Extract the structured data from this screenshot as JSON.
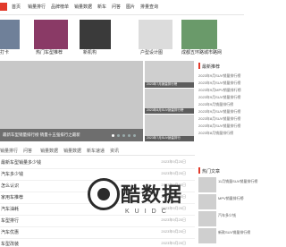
{
  "nav": {
    "items": [
      "首页",
      "销量排行",
      "品牌榜单",
      "销量数据",
      "新车",
      "问答",
      "图片",
      "排量查询"
    ]
  },
  "hero": [
    {
      "caption": "打卡",
      "color": "#6f8099"
    },
    {
      "caption": "热门车型推荐",
      "color": "#8a3a66"
    },
    {
      "caption": "新机构",
      "color": "#3a3a3a"
    },
    {
      "caption": "户型设计图",
      "color": "#dcdcdc"
    },
    {
      "caption": "成都五环路城市路网",
      "color": "#6a9a6a"
    }
  ],
  "slider": {
    "caption": "最新车型销量排行榜 销量十五强排行之最新"
  },
  "thumbs": [
    {
      "caption": "2023年7月销量排行榜"
    },
    {
      "caption": "2023年8月SUV销量排行榜"
    },
    {
      "caption": "2023年7月SUV销量排行"
    }
  ],
  "latest": {
    "title": "最新推荐",
    "items": [
      "2023年9月SUV销量排行榜",
      "2023年9月SUV销量排行榜",
      "2023年9月MPV销量排行榜",
      "2023年9月SUV销量排行榜",
      "2023年9月销量排行榜",
      "2023年9月SUV销量排行榜",
      "2023年8月SUV销量排行榜",
      "2023年8月SUV销量排行榜",
      "2023年8月销量排行榜"
    ]
  },
  "tabs": [
    "销量排行",
    "问答",
    "销量数据",
    "销量数据",
    "新车速递",
    "资讯"
  ],
  "list": [
    {
      "title": "最新车型销量多少钱",
      "date": "2023年9月20日"
    },
    {
      "title": "汽车多少钱",
      "date": "2023年9月20日"
    },
    {
      "title": "怎么认识",
      "date": "2023年9月20日"
    },
    {
      "title": "家用车推荐",
      "date": "2023年9月20日"
    },
    {
      "title": "汽车油耗",
      "date": "2023年9月20日"
    },
    {
      "title": "车型排行",
      "date": "2023年9月20日"
    },
    {
      "title": "汽车优惠",
      "date": "2023年9月20日"
    },
    {
      "title": "车型改装",
      "date": "2023年9月20日"
    },
    {
      "title": "销量排行榜数据",
      "date": "2023年9月20日"
    },
    {
      "title": "SUV销量排行",
      "date": "2023年9月20日"
    }
  ],
  "hot": {
    "title": "热门文章",
    "items": [
      "11月销量SUV销量排行榜",
      "MPV销量排行榜",
      "汽车多少钱",
      "新款SUV销量排行榜",
      "汽车油耗怎么样"
    ]
  },
  "watermark": {
    "title": "酷数据",
    "sub": "KUIDC"
  }
}
